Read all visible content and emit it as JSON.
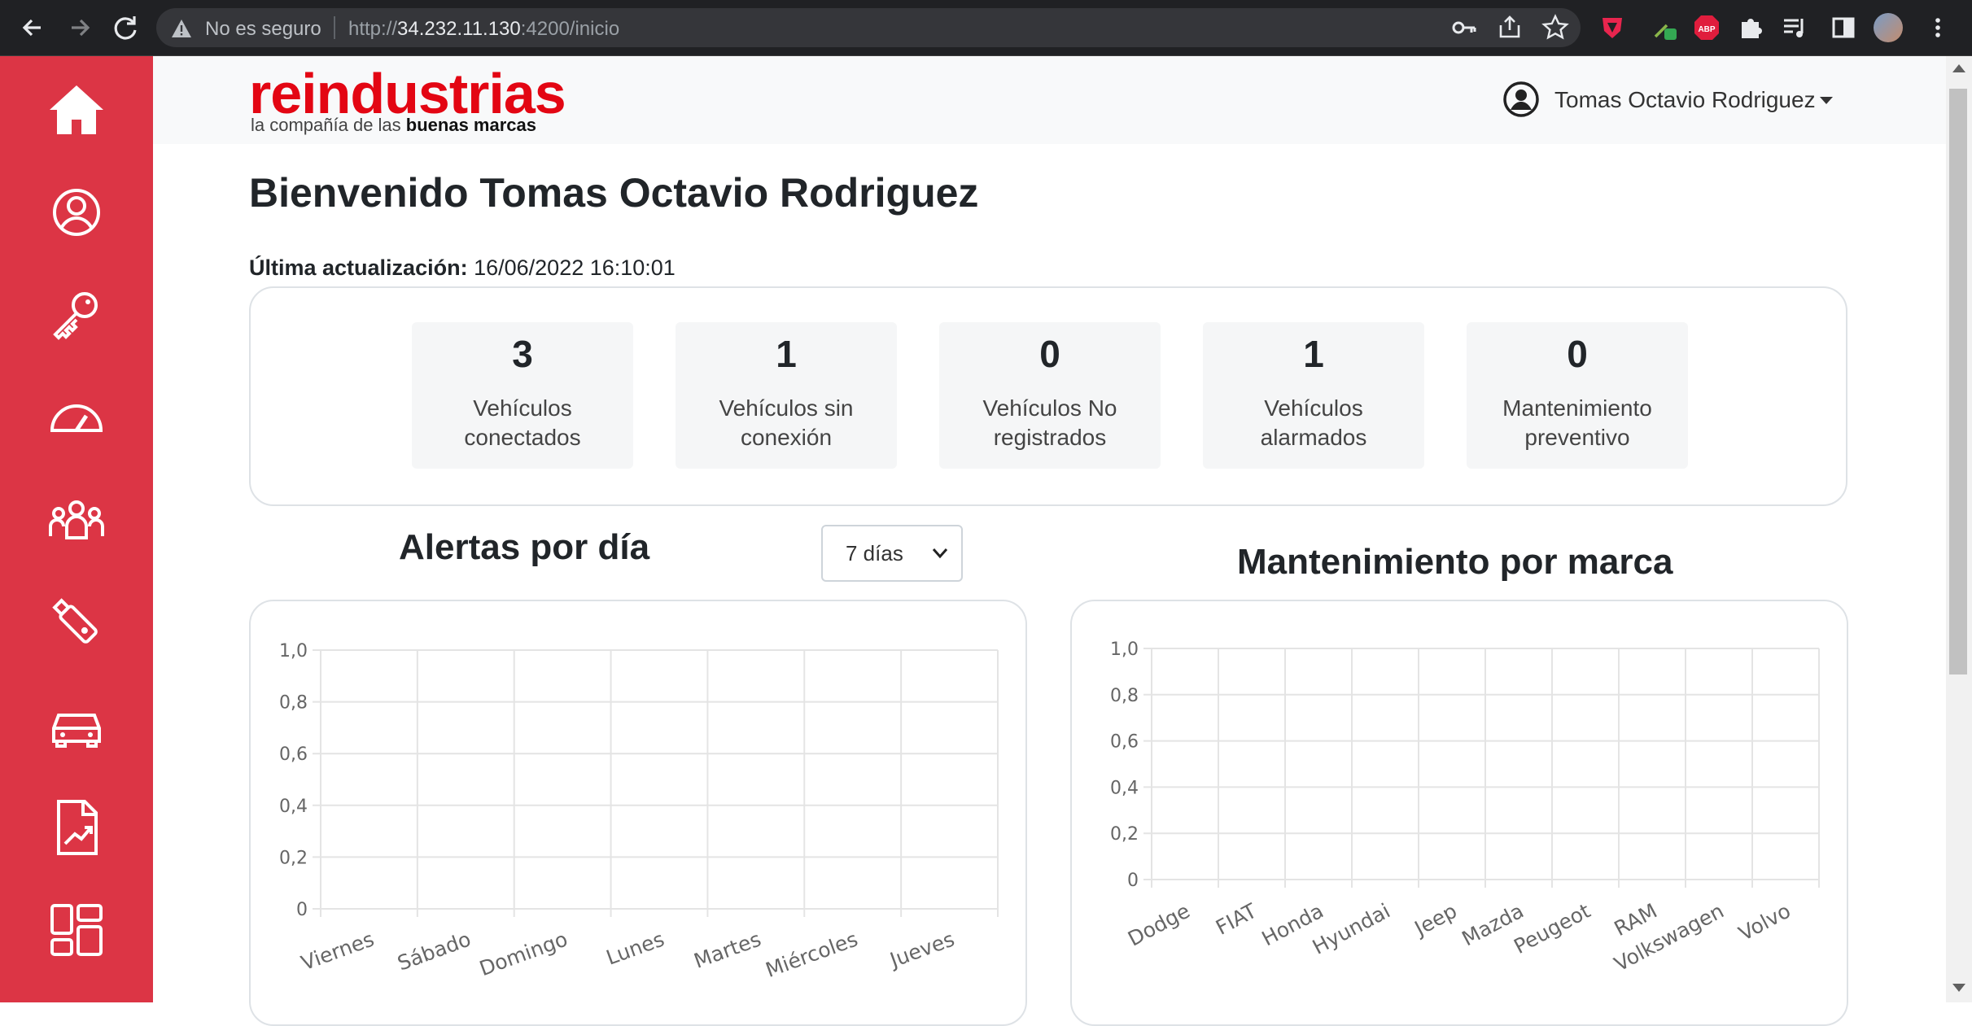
{
  "browser": {
    "security_label": "No es seguro",
    "url_prefix": "http://",
    "url_host": "34.232.11.130",
    "url_path": ":4200/inicio",
    "extension_badge": "ABP"
  },
  "logo": {
    "name": "reindustrias",
    "tagline_start": "la compañía de las ",
    "tagline_bold": "buenas marcas"
  },
  "sidebar": {
    "items": [
      {
        "icon": "home-icon",
        "label": "Inicio"
      },
      {
        "icon": "user-circle-icon",
        "label": "Usuario"
      },
      {
        "icon": "key-icon",
        "label": "Llaves"
      },
      {
        "icon": "speedometer-icon",
        "label": "Tablero"
      },
      {
        "icon": "group-icon",
        "label": "Grupos"
      },
      {
        "icon": "usb-drive-icon",
        "label": "Dispositivos"
      },
      {
        "icon": "car-icon",
        "label": "Vehículos"
      },
      {
        "icon": "report-icon",
        "label": "Reportes"
      },
      {
        "icon": "dashboard-grid-icon",
        "label": "Panel"
      }
    ]
  },
  "header": {
    "user_name": "Tomas Octavio Rodriguez"
  },
  "main": {
    "title": "Bienvenido Tomas Octavio Rodriguez",
    "last_update_label": "Última actualización:",
    "last_update_value": "16/06/2022 16:10:01",
    "stats": [
      {
        "value": "3",
        "label_line1": "Vehículos",
        "label_line2": "conectados"
      },
      {
        "value": "1",
        "label_line1": "Vehículos sin",
        "label_line2": "conexión"
      },
      {
        "value": "0",
        "label_line1": "Vehículos No",
        "label_line2": "registrados"
      },
      {
        "value": "1",
        "label_line1": "Vehículos",
        "label_line2": "alarmados"
      },
      {
        "value": "0",
        "label_line1": "Mantenimiento",
        "label_line2": "preventivo"
      }
    ],
    "alerts_title": "Alertas por día",
    "days_select": {
      "selected": "7 días"
    },
    "maintenance_title": "Mantenimiento por marca"
  },
  "chart_data": [
    {
      "type": "bar",
      "title": "Alertas por día",
      "categories": [
        "Viernes",
        "Sábado",
        "Domingo",
        "Lunes",
        "Martes",
        "Miércoles",
        "Jueves"
      ],
      "values": [
        0,
        0,
        0,
        0,
        0,
        0,
        0
      ],
      "ylim": [
        0,
        1.0
      ],
      "yticks": [
        "0",
        "0,2",
        "0,4",
        "0,6",
        "0,8",
        "1,0"
      ],
      "grid": true
    },
    {
      "type": "bar",
      "title": "Mantenimiento por marca",
      "categories": [
        "Dodge",
        "FIAT",
        "Honda",
        "Hyundai",
        "Jeep",
        "Mazda",
        "Peugeot",
        "RAM",
        "Volkswagen",
        "Volvo"
      ],
      "values": [
        0,
        0,
        0,
        0,
        0,
        0,
        0,
        0,
        0,
        0
      ],
      "ylim": [
        0,
        1.0
      ],
      "yticks": [
        "0",
        "0,2",
        "0,4",
        "0,6",
        "0,8",
        "1,0"
      ],
      "grid": true
    }
  ]
}
